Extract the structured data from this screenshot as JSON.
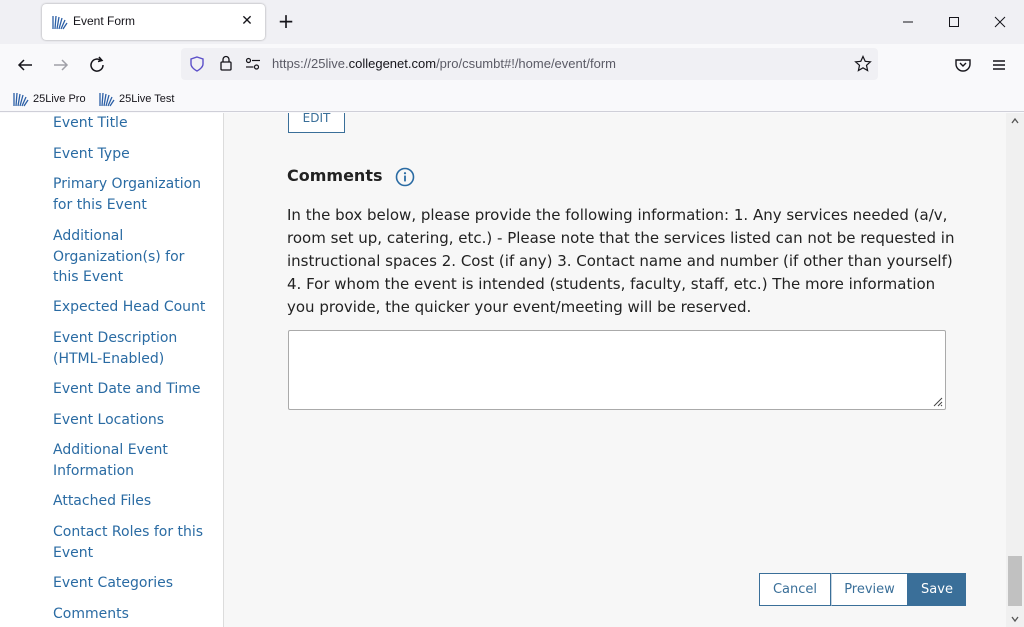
{
  "browser": {
    "tab_title": "Event Form",
    "url_prefix": "https://25live.",
    "url_host": "collegenet.com",
    "url_path": "/pro/csumbt#!/home/event/form",
    "bookmarks": [
      "25Live Pro",
      "25Live Test"
    ]
  },
  "sidebar": {
    "items": [
      "Event Title",
      "Event Type",
      "Primary Organization for this Event",
      "Additional Organization(s) for this Event",
      "Expected Head Count",
      "Event Description (HTML-Enabled)",
      "Event Date and Time",
      "Event Locations",
      "Additional Event Information",
      "Attached Files",
      "Contact Roles for this Event",
      "Event Categories",
      "Comments"
    ]
  },
  "form": {
    "edit_label": "EDIT",
    "comments_heading": "Comments",
    "comments_instructions": "In the box below, please provide the following information: 1. Any services needed (a/v, room set up, catering, etc.) - Please note that the services listed can not be requested in instructional spaces 2. Cost (if any) 3. Contact name and number (if other than yourself) 4. For whom the event is intended (students, faculty, staff, etc.) The more information you provide, the quicker your event/meeting will be reserved.",
    "comments_value": ""
  },
  "actions": {
    "cancel": "Cancel",
    "preview": "Preview",
    "save": "Save"
  },
  "colors": {
    "link": "#2a6ba3",
    "primary": "#3a6f99"
  }
}
